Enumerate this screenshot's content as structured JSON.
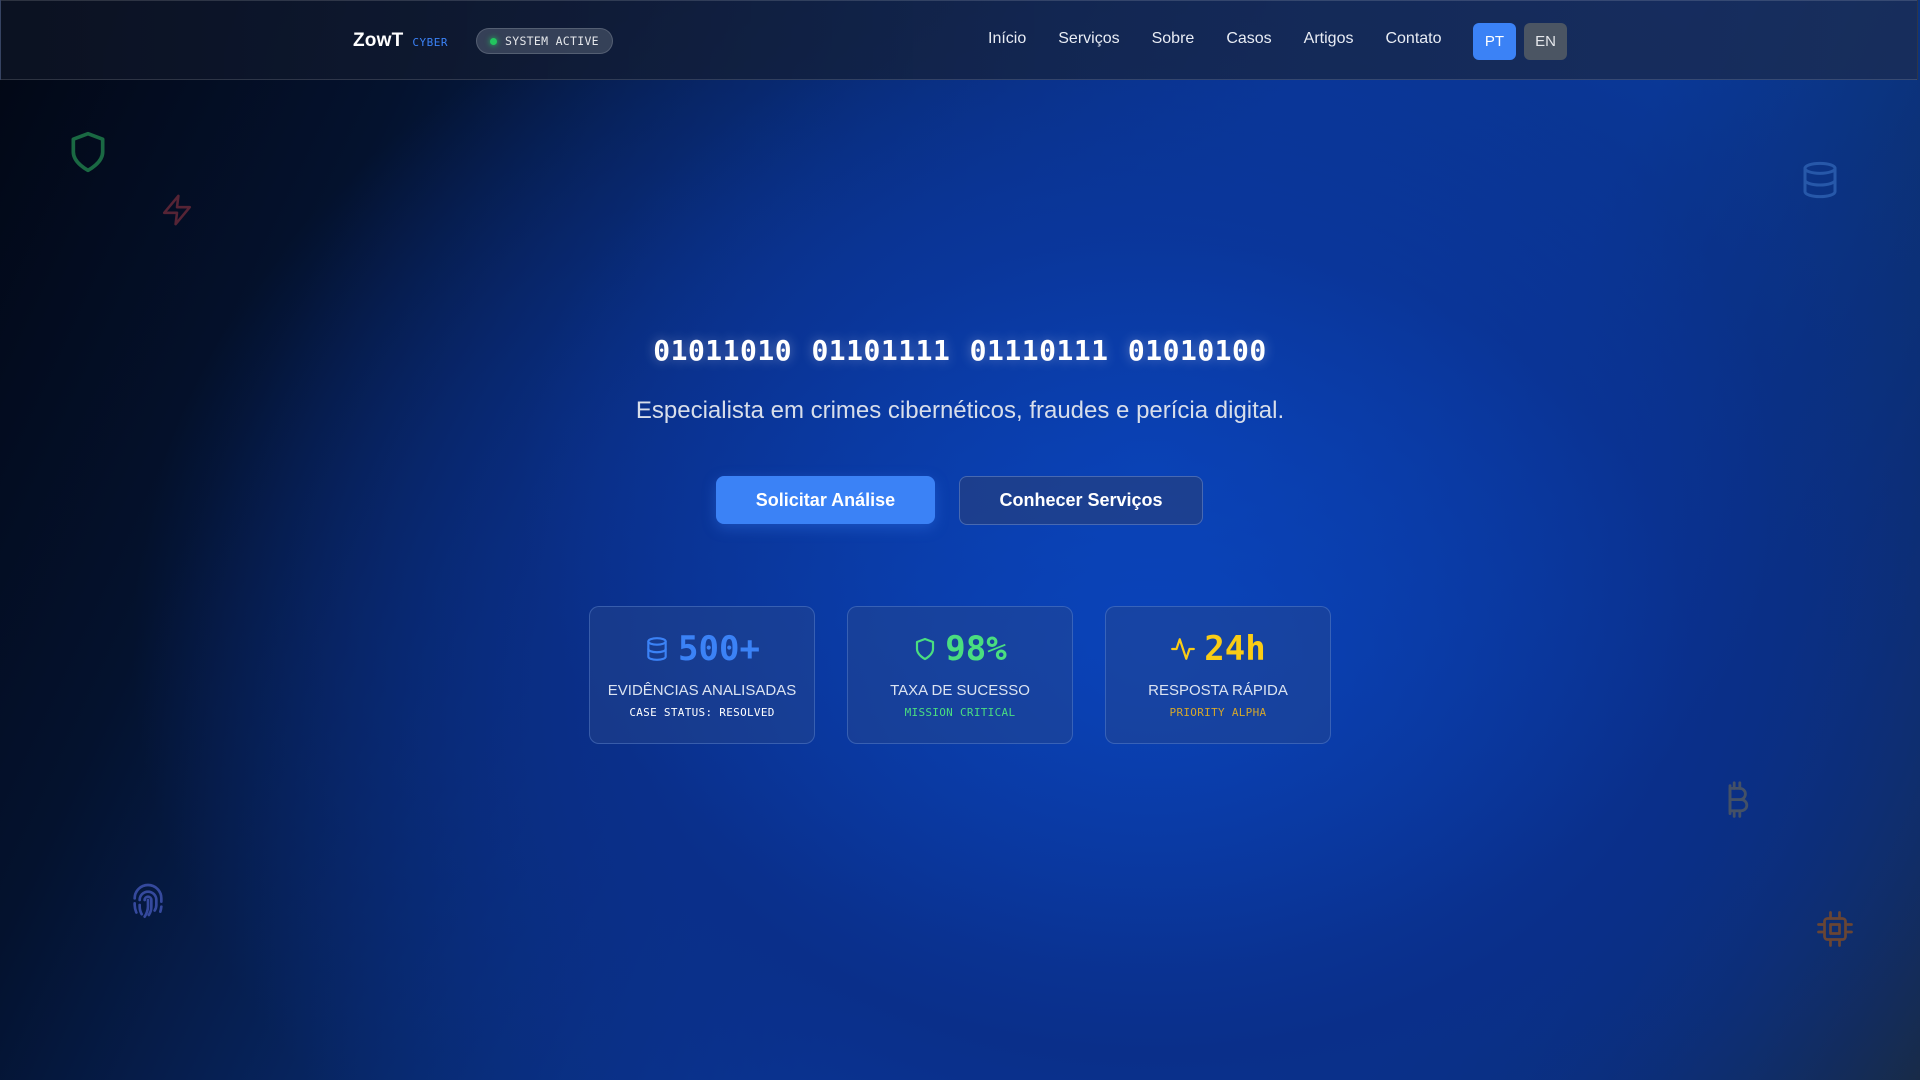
{
  "header": {
    "brand_name": "ZowT",
    "brand_tag": "CYBER",
    "status": "SYSTEM ACTIVE",
    "nav": [
      "Início",
      "Serviços",
      "Sobre",
      "Casos",
      "Artigos",
      "Contato"
    ],
    "languages": [
      "PT",
      "EN"
    ],
    "active_language": "PT"
  },
  "hero": {
    "binary": "01011010 01101111 01110111 01010100",
    "subtitle": "Especialista em crimes cibernéticos, fraudes e perícia digital.",
    "primary_cta": "Solicitar Análise",
    "secondary_cta": "Conhecer Serviços"
  },
  "stats": [
    {
      "icon": "database-icon",
      "value": "500+",
      "label": "EVIDÊNCIAS ANALISADAS",
      "sub": "CASE STATUS: RESOLVED",
      "color": "#3b82f6",
      "sub_color": "#ffffff"
    },
    {
      "icon": "shield-icon",
      "value": "98%",
      "label": "TAXA DE SUCESSO",
      "sub": "MISSION CRITICAL",
      "color": "#4ade80",
      "sub_color": "#4ade80"
    },
    {
      "icon": "activity-icon",
      "value": "24h",
      "label": "RESPOSTA RÁPIDA",
      "sub": "PRIORITY ALPHA",
      "color": "#facc15",
      "sub_color": "#d4a72c"
    }
  ],
  "decorations": [
    "shield-icon",
    "zap-icon",
    "database-icon",
    "bitcoin-icon",
    "fingerprint-icon",
    "cpu-icon"
  ],
  "colors": {
    "accent": "#3b82f6",
    "status_active": "#22c55e"
  }
}
